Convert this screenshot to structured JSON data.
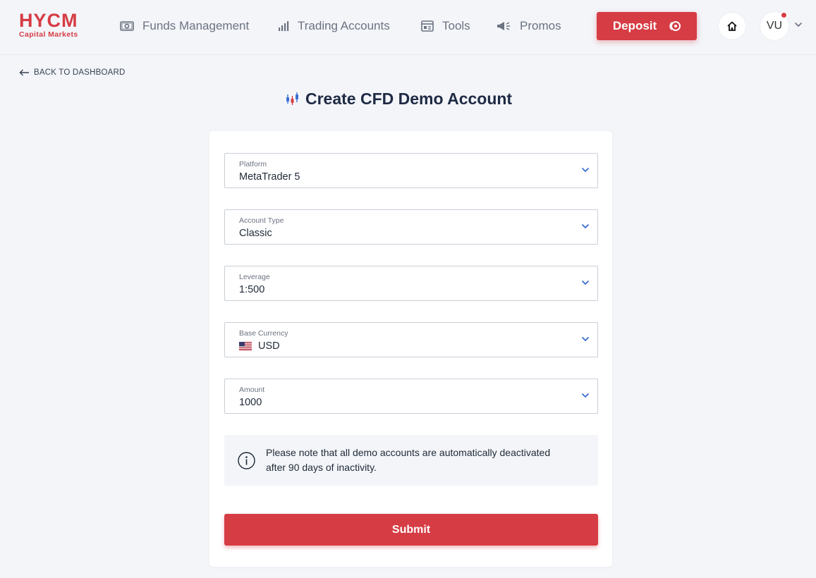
{
  "logo": {
    "main": "HYCM",
    "sub": "Capital Markets"
  },
  "nav": {
    "funds": "Funds Management",
    "trading": "Trading Accounts",
    "tools": "Tools",
    "promos": "Promos"
  },
  "header": {
    "deposit_label": "Deposit",
    "avatar_initials": "VU"
  },
  "back_link": "BACK TO DASHBOARD",
  "page_title": "Create CFD Demo Account",
  "form": {
    "platform": {
      "label": "Platform",
      "value": "MetaTrader 5"
    },
    "account_type": {
      "label": "Account Type",
      "value": "Classic"
    },
    "leverage": {
      "label": "Leverage",
      "value": "1:500"
    },
    "base_currency": {
      "label": "Base Currency",
      "value": "USD",
      "flag_icon": "us-flag-icon"
    },
    "amount": {
      "label": "Amount",
      "value": "1000"
    }
  },
  "note": "Please note that all demo accounts are automatically deactivated after 90 days of inactivity.",
  "submit_label": "Submit",
  "colors": {
    "brand_red": "#d63c44",
    "background": "#f3f5f9",
    "chevron_blue": "#3b6fd4",
    "title_navy": "#1f2a44"
  }
}
